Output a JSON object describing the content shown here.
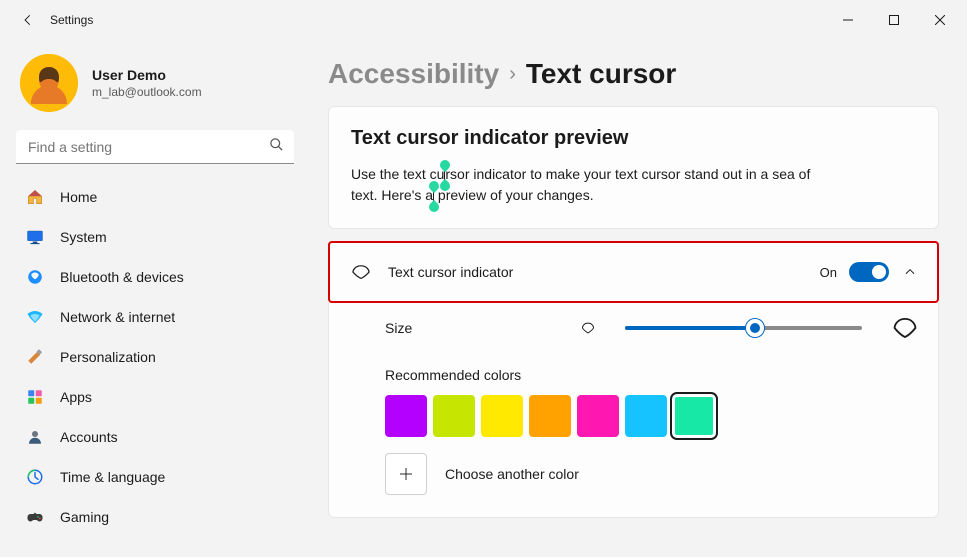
{
  "window": {
    "title": "Settings"
  },
  "user": {
    "name": "User Demo",
    "email": "m_lab@outlook.com"
  },
  "search": {
    "placeholder": "Find a setting"
  },
  "nav": {
    "items": [
      {
        "label": "Home"
      },
      {
        "label": "System"
      },
      {
        "label": "Bluetooth & devices"
      },
      {
        "label": "Network & internet"
      },
      {
        "label": "Personalization"
      },
      {
        "label": "Apps"
      },
      {
        "label": "Accounts"
      },
      {
        "label": "Time & language"
      },
      {
        "label": "Gaming"
      }
    ]
  },
  "breadcrumb": {
    "parent": "Accessibility",
    "current": "Text cursor"
  },
  "preview": {
    "heading": "Text cursor indicator preview",
    "text_before": "Use the text cu",
    "text_mid": "rsor indicator to make your text cursor stand out in a sea of text. Here's a",
    "text_after": " preview of your changes."
  },
  "indicator": {
    "label": "Text cursor indicator",
    "state": "On",
    "toggle": true
  },
  "size": {
    "label": "Size",
    "value_percent": 55
  },
  "colors": {
    "heading": "Recommended colors",
    "swatches": [
      "#b300ff",
      "#c6e500",
      "#ffe900",
      "#ffa200",
      "#ff17b1",
      "#17c3ff",
      "#17e8a6"
    ],
    "selected_index": 6,
    "more_label": "Choose another color"
  }
}
